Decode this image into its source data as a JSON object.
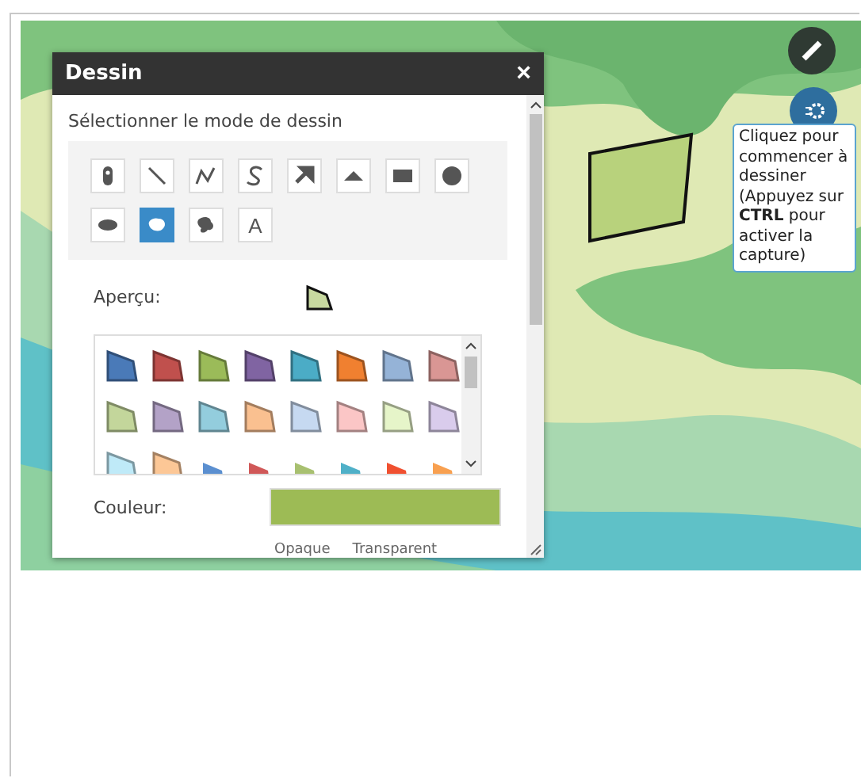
{
  "dialog": {
    "title": "Dessin",
    "close": "×",
    "mode_label": "Sélectionner le mode de dessin",
    "tools": [
      {
        "kind": "point",
        "selected": false
      },
      {
        "kind": "line",
        "selected": false
      },
      {
        "kind": "polyline",
        "selected": false
      },
      {
        "kind": "freehand",
        "selected": false
      },
      {
        "kind": "arrow",
        "selected": false
      },
      {
        "kind": "triangle",
        "selected": false
      },
      {
        "kind": "rectangle",
        "selected": false
      },
      {
        "kind": "circle",
        "selected": false
      },
      {
        "kind": "ellipse",
        "selected": false
      },
      {
        "kind": "blob",
        "selected": true
      },
      {
        "kind": "freeblob",
        "selected": false
      },
      {
        "kind": "text",
        "label": "A",
        "selected": false
      }
    ],
    "preview_label": "Aperçu:",
    "preview": {
      "color": "#c8d9a0"
    },
    "symbols": [
      {
        "kind": "outlined",
        "color": "#4a7ab8"
      },
      {
        "kind": "outlined",
        "color": "#c0504d"
      },
      {
        "kind": "outlined",
        "color": "#9bbb59"
      },
      {
        "kind": "outlined",
        "color": "#8064a2"
      },
      {
        "kind": "outlined",
        "color": "#4bacc6"
      },
      {
        "kind": "outlined",
        "color": "#f08030"
      },
      {
        "kind": "outlined",
        "color": "#95b3d7"
      },
      {
        "kind": "outlined",
        "color": "#d99694"
      },
      {
        "kind": "outlined",
        "color": "#c3d69b"
      },
      {
        "kind": "outlined",
        "color": "#b3a2c7"
      },
      {
        "kind": "outlined",
        "color": "#93cddd"
      },
      {
        "kind": "outlined",
        "color": "#fac090"
      },
      {
        "kind": "outlined",
        "color": "#c6d9f1"
      },
      {
        "kind": "outlined",
        "color": "#fbc6c6"
      },
      {
        "kind": "outlined",
        "color": "#e6f5c9"
      },
      {
        "kind": "outlined",
        "color": "#d9ccec"
      },
      {
        "kind": "outlined",
        "color": "#bfeaf8"
      },
      {
        "kind": "outlined",
        "color": "#fcc796"
      },
      {
        "kind": "small",
        "color": "#5b8fd0"
      },
      {
        "kind": "small",
        "color": "#d05858"
      },
      {
        "kind": "small",
        "color": "#a8c070"
      },
      {
        "kind": "small",
        "color": "#4fb0c8"
      },
      {
        "kind": "small",
        "color": "#f05030"
      },
      {
        "kind": "small",
        "color": "#f8a050"
      }
    ],
    "color_label": "Couleur:",
    "color_swatch": {
      "color": "#9dbb55"
    },
    "opacity_labels": [
      "Opaque",
      "Transparent"
    ]
  },
  "tooltip": "Cliquez pour commencer à dessiner (Appuyez sur **CTRL** pour activer la capture)"
}
